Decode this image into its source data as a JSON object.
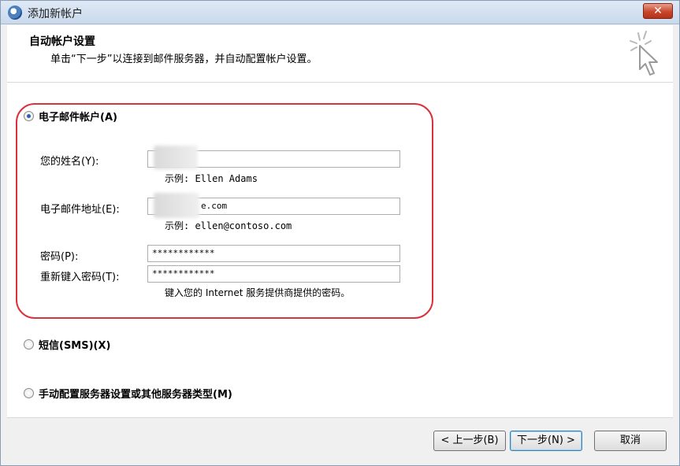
{
  "window": {
    "title": "添加新帐户",
    "close_glyph": "✕"
  },
  "header": {
    "title": "自动帐户设置",
    "subtitle": "单击“下一步”以连接到邮件服务器，并自动配置帐户设置。"
  },
  "options": {
    "email": {
      "label": "电子邮件帐户(A)",
      "selected": true
    },
    "sms": {
      "label": "短信(SMS)(X)",
      "selected": false
    },
    "manual": {
      "label": "手动配置服务器设置或其他服务器类型(M)",
      "selected": false
    }
  },
  "form": {
    "name": {
      "label": "您的姓名(Y):",
      "value": "",
      "hint": "示例: Ellen Adams"
    },
    "email": {
      "label": "电子邮件地址(E):",
      "value": "e.com",
      "hint": "示例: ellen@contoso.com"
    },
    "password": {
      "label": "密码(P):",
      "value": "************"
    },
    "retype": {
      "label": "重新键入密码(T):",
      "value": "************"
    },
    "password_hint": "键入您的 Internet 服务提供商提供的密码。"
  },
  "buttons": {
    "back": "< 上一步(B)",
    "next": "下一步(N) >",
    "cancel": "取消"
  },
  "colors": {
    "highlight_border": "#d8323d",
    "radio_dot": "#2b5fb0"
  }
}
